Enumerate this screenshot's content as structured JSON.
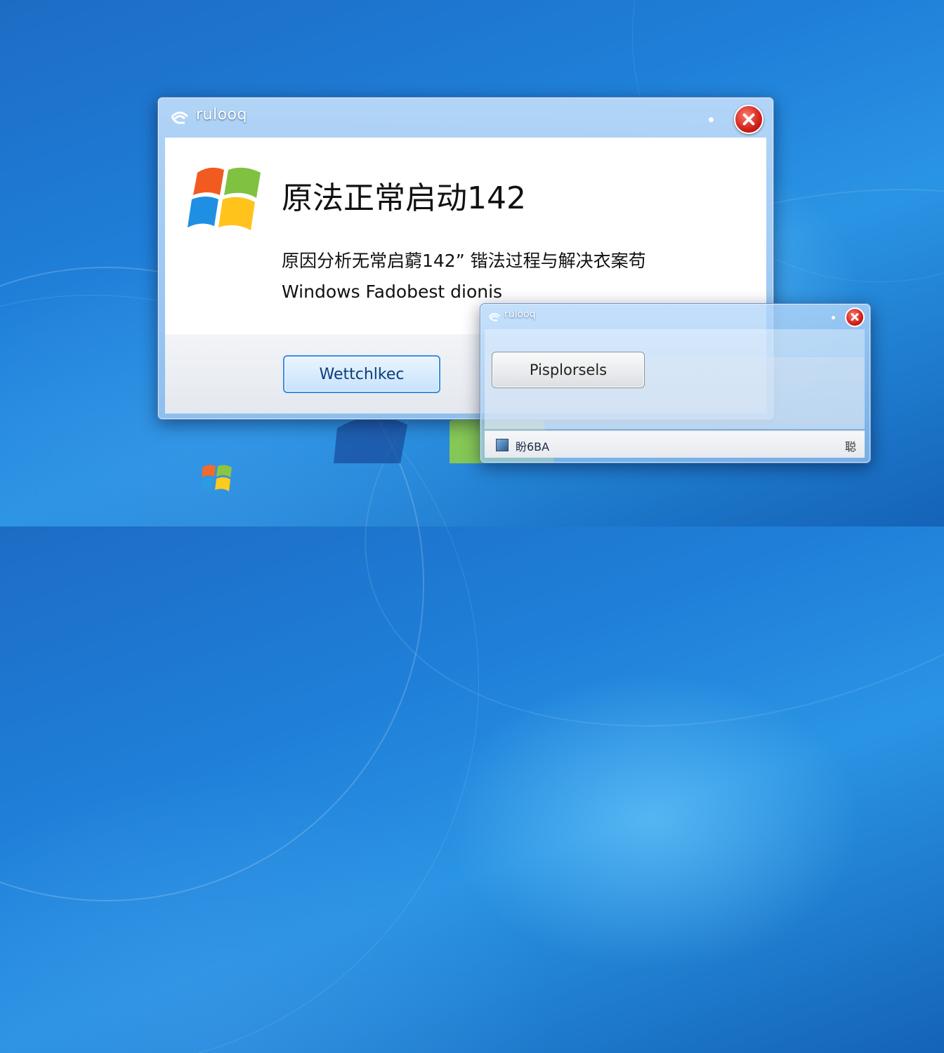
{
  "main_dialog": {
    "title": "rulooq",
    "heading": "原法正常启动142",
    "description": "原因分析无常启藭142” 锴法过程与解决衣案苟",
    "subtext": "Windows  Fadobest dionis",
    "primary_button": "Wettchlke‌c"
  },
  "secondary_dialog": {
    "title": "rulooq",
    "button": "Pisplorsels",
    "status_text": "盼6BA",
    "status_right": "聪"
  },
  "icons": {
    "app": "wifi-logo-icon",
    "close": "close-icon",
    "windows_logo": "windows-logo-icon"
  },
  "colors": {
    "desktop": "#1f7fd8",
    "close_red": "#d0201a",
    "primary_border": "#3b8ee0"
  }
}
